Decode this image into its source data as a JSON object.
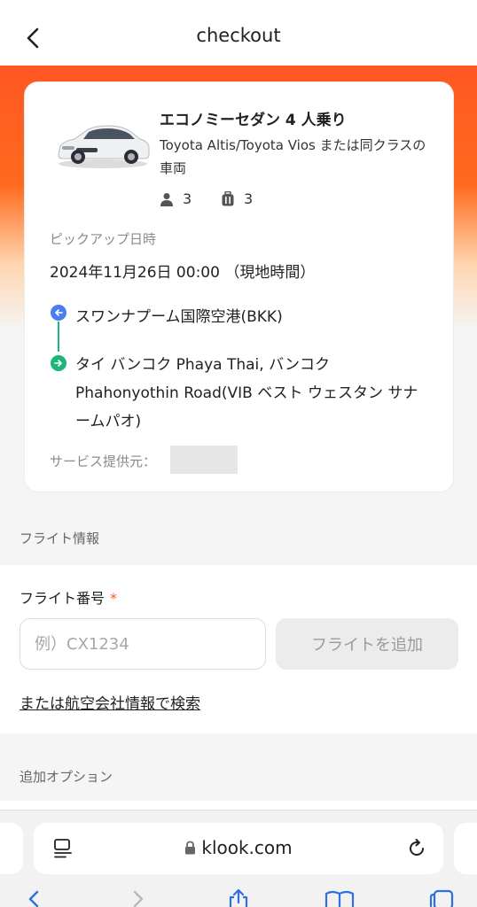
{
  "header": {
    "title": "checkout",
    "back_icon": "chevron-left-icon"
  },
  "booking": {
    "car_name": "エコノミーセダン 4 人乗り",
    "car_desc": "Toyota Altis/Toyota Vios または同クラスの車両",
    "passengers": "3",
    "luggage": "3",
    "pickup_label": "ピックアップ日時",
    "pickup_datetime": "2024年11月26日 00:00 （現地時間）",
    "from": "スワンナプーム国際空港(BKK)",
    "to": "タイ バンコク Phaya Thai, バンコク Phahonyothin Road(VIB ベスト ウェスタン サナームパオ)",
    "provider_label": "サービス提供元："
  },
  "flight": {
    "section_label": "フライト情報",
    "field_label": "フライト番号",
    "required_mark": "*",
    "placeholder": "例）CX1234",
    "add_button": "フライトを追加",
    "search_link": "または航空会社情報で検索"
  },
  "options": {
    "section_label": "追加オプション"
  },
  "browser": {
    "url": "klook.com"
  },
  "colors": {
    "accent": "#ff5722",
    "from_dot": "#4a7df0",
    "to_dot": "#1db57a",
    "link_blue": "#2f6fe0"
  }
}
